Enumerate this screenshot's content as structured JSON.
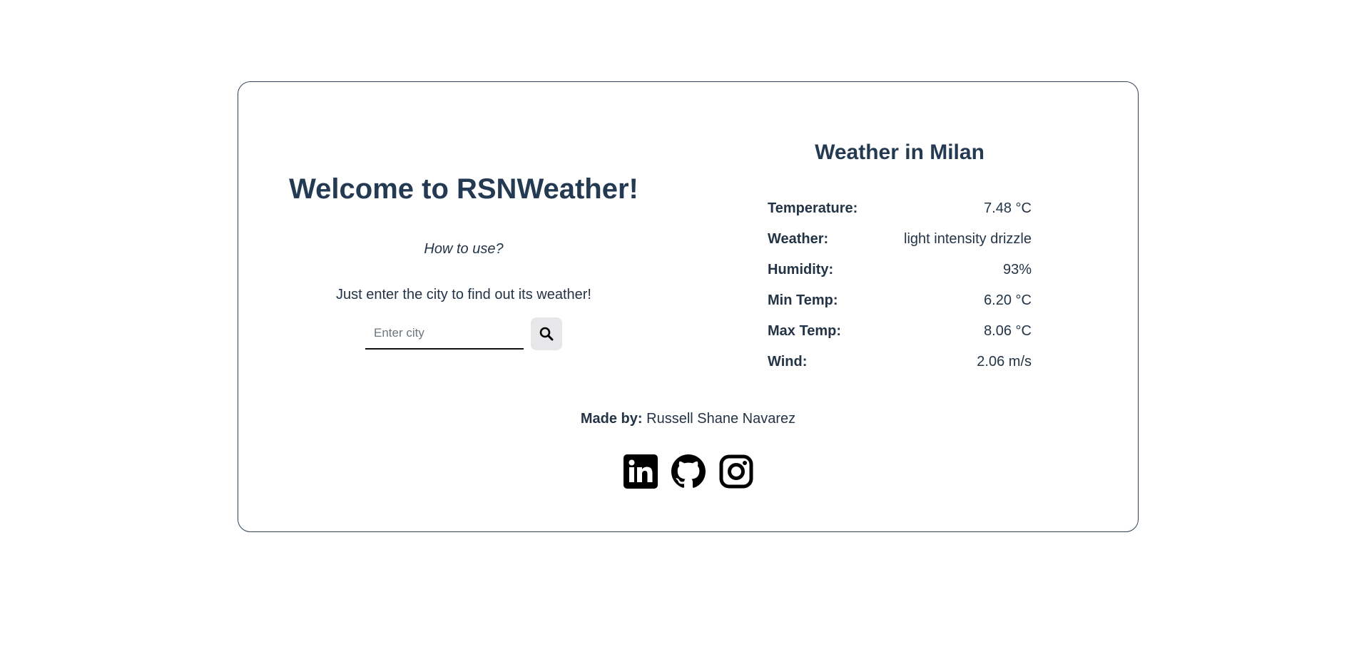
{
  "welcome": {
    "title": "Welcome to RSNWeather!",
    "how_to": "How to use?",
    "instructions": "Just enter the city to find out its weather!"
  },
  "search": {
    "placeholder": "Enter city",
    "value": "",
    "button_icon": "search-icon"
  },
  "weather": {
    "title": "Weather in Milan",
    "rows": [
      {
        "label": "Temperature:",
        "value": "7.48 °C"
      },
      {
        "label": "Weather:",
        "value": "light intensity drizzle"
      },
      {
        "label": "Humidity:",
        "value": "93%"
      },
      {
        "label": "Min Temp:",
        "value": "6.20 °C"
      },
      {
        "label": "Max Temp:",
        "value": "8.06 °C"
      },
      {
        "label": "Wind:",
        "value": "2.06 m/s"
      }
    ]
  },
  "footer": {
    "made_by_label": "Made by:",
    "author": "Russell Shane Navarez",
    "socials": [
      "linkedin-icon",
      "github-icon",
      "instagram-icon"
    ]
  },
  "colors": {
    "text": "#233446",
    "border": "#2f4256",
    "button_bg": "#e7e7ea"
  }
}
